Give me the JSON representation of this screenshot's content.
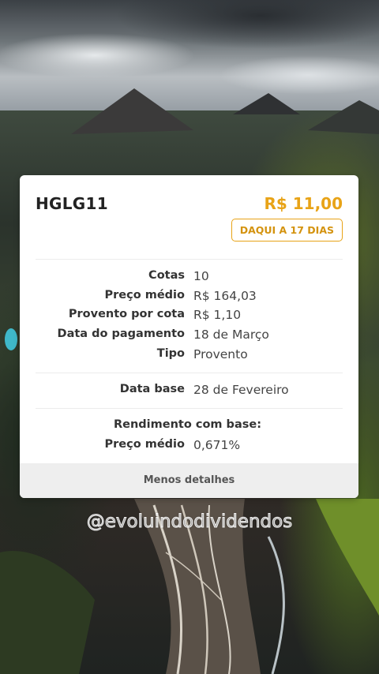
{
  "card": {
    "ticker": "HGLG11",
    "amount": "R$ 11,00",
    "badge": "DAQUI A 17 DIAS",
    "details": [
      {
        "label": "Cotas",
        "value": "10"
      },
      {
        "label": "Preço médio",
        "value": "R$ 164,03"
      },
      {
        "label": "Provento por cota",
        "value": "R$ 1,10"
      },
      {
        "label": "Data do pagamento",
        "value": "18 de Março"
      },
      {
        "label": "Tipo",
        "value": "Provento"
      }
    ],
    "base": {
      "label": "Data base",
      "value": "28 de Fevereiro"
    },
    "yield_heading": "Rendimento com base:",
    "yield": {
      "label": "Preço médio",
      "value": "0,671%"
    },
    "footer_link": "Menos detalhes"
  },
  "watermark": "@evoluindodividendos",
  "colors": {
    "accent": "#e8a317",
    "card": "#ffffff",
    "footer": "#eeeeee"
  }
}
